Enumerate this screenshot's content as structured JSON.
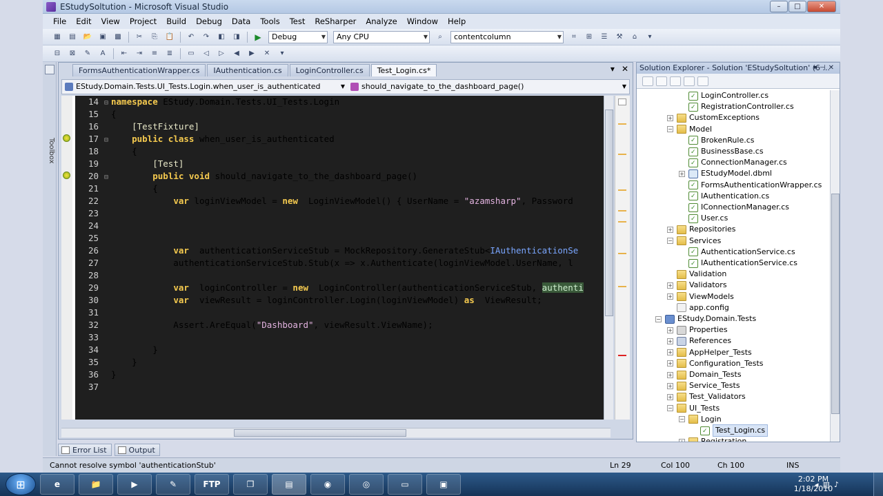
{
  "window": {
    "title": "EStudySoltution - Microsoft Visual Studio",
    "minimize": "–",
    "maximize": "□",
    "close": "✕"
  },
  "menu": [
    "File",
    "Edit",
    "View",
    "Project",
    "Build",
    "Debug",
    "Data",
    "Tools",
    "Test",
    "ReSharper",
    "Analyze",
    "Window",
    "Help"
  ],
  "toolbar": {
    "config": "Debug",
    "platform": "Any CPU",
    "find": "contentcolumn"
  },
  "toolbox_label": "Toolbox",
  "tabs": [
    {
      "label": "FormsAuthenticationWrapper.cs"
    },
    {
      "label": "IAuthentication.cs"
    },
    {
      "label": "LoginController.cs"
    },
    {
      "label": "Test_Login.cs*"
    }
  ],
  "nav": {
    "class": "EStudy.Domain.Tests.UI_Tests.Login.when_user_is_authenticated",
    "member": "should_navigate_to_the_dashboard_page()"
  },
  "code": {
    "lines": [
      {
        "n": "14",
        "fold": "⊟",
        "t": [
          [
            "kw",
            "namespace"
          ],
          [
            "",
            "EStudy.Domain.Tests.UI_Tests.Login"
          ]
        ]
      },
      {
        "n": "15",
        "fold": "",
        "t": [
          [
            "",
            "{"
          ]
        ]
      },
      {
        "n": "16",
        "fold": "",
        "t": [
          [
            "",
            "    "
          ],
          [
            "attr",
            "[TestFixture]"
          ]
        ]
      },
      {
        "n": "17",
        "fold": "⊟",
        "t": [
          [
            "",
            "    "
          ],
          [
            "kw",
            "public class"
          ],
          [
            "",
            "when_user_is_authenticated"
          ]
        ]
      },
      {
        "n": "18",
        "fold": "",
        "t": [
          [
            "",
            "    {"
          ]
        ]
      },
      {
        "n": "19",
        "fold": "",
        "t": [
          [
            "",
            "        "
          ],
          [
            "attr",
            "[Test]"
          ]
        ]
      },
      {
        "n": "20",
        "fold": "⊟",
        "t": [
          [
            "",
            "        "
          ],
          [
            "kw",
            "public void"
          ],
          [
            "",
            "should_navigate_to_the_dashboard_page()"
          ]
        ]
      },
      {
        "n": "21",
        "fold": "",
        "t": [
          [
            "",
            "        {"
          ]
        ]
      },
      {
        "n": "22",
        "fold": "",
        "t": [
          [
            "",
            "            "
          ],
          [
            "kw",
            "var"
          ],
          [
            "",
            "loginViewModel = "
          ],
          [
            "kw",
            "new"
          ],
          [
            "",
            " LoginViewModel() { UserName = "
          ],
          [
            "str",
            "\"azamsharp\""
          ],
          [
            "",
            ", Password"
          ]
        ]
      },
      {
        "n": "23",
        "fold": "",
        "t": [
          [
            "",
            ""
          ]
        ]
      },
      {
        "n": "24",
        "fold": "",
        "t": [
          [
            "",
            ""
          ]
        ]
      },
      {
        "n": "25",
        "fold": "",
        "t": [
          [
            "",
            ""
          ]
        ]
      },
      {
        "n": "26",
        "fold": "",
        "t": [
          [
            "",
            "            "
          ],
          [
            "kw",
            "var"
          ],
          [
            "",
            " authenticationServiceStub = MockRepository.GenerateStub<"
          ],
          [
            "iface",
            "IAuthenticationSe"
          ]
        ]
      },
      {
        "n": "27",
        "fold": "",
        "t": [
          [
            "",
            "            authenticationServiceStub.Stub(x => x.Authenticate(loginViewModel.UserName, l"
          ]
        ]
      },
      {
        "n": "28",
        "fold": "",
        "t": [
          [
            "",
            ""
          ]
        ]
      },
      {
        "n": "29",
        "fold": "",
        "t": [
          [
            "",
            "            "
          ],
          [
            "kw",
            "var"
          ],
          [
            "",
            " loginController = "
          ],
          [
            "kw",
            "new"
          ],
          [
            "",
            " LoginController(authenticationServiceStub, "
          ],
          [
            "hl",
            "authenti"
          ]
        ]
      },
      {
        "n": "30",
        "fold": "",
        "t": [
          [
            "",
            "            "
          ],
          [
            "kw",
            "var"
          ],
          [
            "",
            " viewResult = loginController.Login(loginViewModel) "
          ],
          [
            "kw",
            "as"
          ],
          [
            "",
            " ViewResult;"
          ]
        ]
      },
      {
        "n": "31",
        "fold": "",
        "t": [
          [
            "",
            ""
          ]
        ]
      },
      {
        "n": "32",
        "fold": "",
        "t": [
          [
            "",
            "            Assert.AreEqual("
          ],
          [
            "str",
            "\"Dashboard\""
          ],
          [
            "",
            ", viewResult.ViewName);"
          ]
        ]
      },
      {
        "n": "33",
        "fold": "",
        "t": [
          [
            "",
            ""
          ]
        ]
      },
      {
        "n": "34",
        "fold": "",
        "t": [
          [
            "",
            "        }"
          ]
        ]
      },
      {
        "n": "35",
        "fold": "",
        "t": [
          [
            "",
            "    }"
          ]
        ]
      },
      {
        "n": "36",
        "fold": "",
        "t": [
          [
            "",
            "}"
          ]
        ]
      },
      {
        "n": "37",
        "fold": "",
        "t": [
          [
            "",
            ""
          ]
        ]
      }
    ]
  },
  "solution": {
    "title": "Solution Explorer - Solution 'EStudySoltution' (6 ...",
    "tree": [
      {
        "label": "LoginController.cs",
        "icon": "cs",
        "depth": 3,
        "exp": ""
      },
      {
        "label": "RegistrationController.cs",
        "icon": "cs",
        "depth": 3,
        "exp": ""
      },
      {
        "label": "CustomExceptions",
        "icon": "folder",
        "depth": 2,
        "exp": "+"
      },
      {
        "label": "Model",
        "icon": "folder",
        "depth": 2,
        "exp": "−"
      },
      {
        "label": "BrokenRule.cs",
        "icon": "cs",
        "depth": 3,
        "exp": ""
      },
      {
        "label": "BusinessBase.cs",
        "icon": "cs",
        "depth": 3,
        "exp": ""
      },
      {
        "label": "ConnectionManager.cs",
        "icon": "cs",
        "depth": 3,
        "exp": ""
      },
      {
        "label": "EStudyModel.dbml",
        "icon": "dbml",
        "depth": 3,
        "exp": "+"
      },
      {
        "label": "FormsAuthenticationWrapper.cs",
        "icon": "cs",
        "depth": 3,
        "exp": ""
      },
      {
        "label": "IAuthentication.cs",
        "icon": "cs",
        "depth": 3,
        "exp": ""
      },
      {
        "label": "IConnectionManager.cs",
        "icon": "cs",
        "depth": 3,
        "exp": ""
      },
      {
        "label": "User.cs",
        "icon": "cs",
        "depth": 3,
        "exp": ""
      },
      {
        "label": "Repositories",
        "icon": "folder",
        "depth": 2,
        "exp": "+"
      },
      {
        "label": "Services",
        "icon": "folder",
        "depth": 2,
        "exp": "−"
      },
      {
        "label": "AuthenticationService.cs",
        "icon": "cs",
        "depth": 3,
        "exp": ""
      },
      {
        "label": "IAuthenticationService.cs",
        "icon": "cs",
        "depth": 3,
        "exp": ""
      },
      {
        "label": "Validation",
        "icon": "folder",
        "depth": 2,
        "exp": ""
      },
      {
        "label": "Validators",
        "icon": "folder",
        "depth": 2,
        "exp": "+"
      },
      {
        "label": "ViewModels",
        "icon": "folder",
        "depth": 2,
        "exp": "+"
      },
      {
        "label": "app.config",
        "icon": "config",
        "depth": 2,
        "exp": ""
      },
      {
        "label": "EStudy.Domain.Tests",
        "icon": "proj",
        "depth": 1,
        "exp": "−"
      },
      {
        "label": "Properties",
        "icon": "props",
        "depth": 2,
        "exp": "+"
      },
      {
        "label": "References",
        "icon": "refs",
        "depth": 2,
        "exp": "+"
      },
      {
        "label": "AppHelper_Tests",
        "icon": "folder",
        "depth": 2,
        "exp": "+"
      },
      {
        "label": "Configuration_Tests",
        "icon": "folder",
        "depth": 2,
        "exp": "+"
      },
      {
        "label": "Domain_Tests",
        "icon": "folder",
        "depth": 2,
        "exp": "+"
      },
      {
        "label": "Service_Tests",
        "icon": "folder",
        "depth": 2,
        "exp": "+"
      },
      {
        "label": "Test_Validators",
        "icon": "folder",
        "depth": 2,
        "exp": "+"
      },
      {
        "label": "UI_Tests",
        "icon": "folder",
        "depth": 2,
        "exp": "−"
      },
      {
        "label": "Login",
        "icon": "folder",
        "depth": 3,
        "exp": "−"
      },
      {
        "label": "Test_Login.cs",
        "icon": "cs",
        "depth": 4,
        "exp": "",
        "selected": true
      },
      {
        "label": "Registration",
        "icon": "folder",
        "depth": 3,
        "exp": "+"
      }
    ]
  },
  "bottom_tabs": [
    "Error List",
    "Output"
  ],
  "status": {
    "message": "Cannot resolve symbol 'authenticationStub'",
    "ln": "Ln 29",
    "col": "Col 100",
    "ch": "Ch 100",
    "mode": "INS"
  },
  "taskbar": {
    "start_glyph": "⊞",
    "apps": [
      "e",
      "📁",
      "▶",
      "✎",
      "FTP",
      "❐",
      "▤",
      "◉",
      "◎",
      "▭",
      "▣"
    ],
    "time": "2:02 PM",
    "date": "1/18/2010"
  },
  "colors": {
    "editor_bg": "#1f1f1f",
    "keyword": "#f5ca4f",
    "string": "#e3b3e0",
    "interface": "#7aa6ff"
  }
}
